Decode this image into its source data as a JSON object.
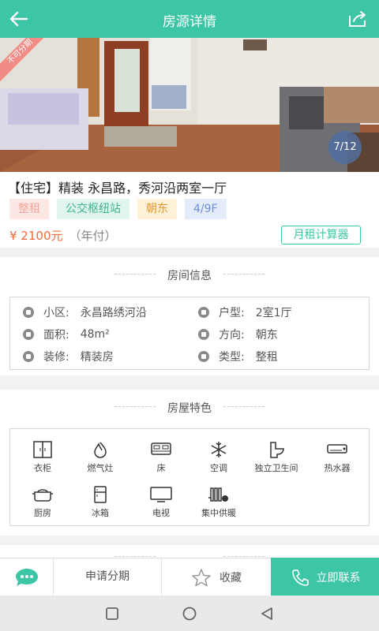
{
  "header": {
    "title": "房源详情",
    "back_icon": "arrow-left-icon",
    "share_icon": "share-icon",
    "bg_color": "#3dc6a5"
  },
  "gallery": {
    "ribbon": "不可分期",
    "counter": "7/12"
  },
  "listing": {
    "name": "【住宅】精装 永昌路，秀河沿两室一厅",
    "tags": [
      "整租",
      "公交枢纽站",
      "朝东",
      "4/9F"
    ],
    "price": "¥ 2100元",
    "price_unit": "（年付）",
    "calc_button": "月租计算器"
  },
  "room_info": {
    "title": "房间信息",
    "rows": [
      [
        {
          "label": "小区:",
          "value": "永昌路绣河沿",
          "icon": "community-icon"
        },
        {
          "label": "户型:",
          "value": "2室1厅",
          "icon": "layout-icon"
        }
      ],
      [
        {
          "label": "面积:",
          "value": "48m²",
          "icon": "area-icon"
        },
        {
          "label": "方向:",
          "value": "朝东",
          "icon": "direction-icon"
        }
      ],
      [
        {
          "label": "装修:",
          "value": "精装房",
          "icon": "decoration-icon"
        },
        {
          "label": "类型:",
          "value": "整租",
          "icon": "type-icon"
        }
      ]
    ]
  },
  "features": {
    "title": "房屋特色",
    "items": [
      {
        "label": "衣柜",
        "icon": "wardrobe-icon"
      },
      {
        "label": "燃气灶",
        "icon": "gas-stove-icon"
      },
      {
        "label": "床",
        "icon": "bed-icon"
      },
      {
        "label": "空调",
        "icon": "air-conditioner-icon"
      },
      {
        "label": "独立卫生间",
        "icon": "bathroom-icon"
      },
      {
        "label": "热水器",
        "icon": "water-heater-icon"
      },
      {
        "label": "厨房",
        "icon": "kitchen-icon"
      },
      {
        "label": "冰箱",
        "icon": "fridge-icon"
      },
      {
        "label": "电视",
        "icon": "tv-icon"
      },
      {
        "label": "集中供暖",
        "icon": "heating-icon"
      }
    ]
  },
  "bottom_bar": {
    "chat_icon": "chat-icon",
    "apply": "申请分期",
    "favorite": "收藏",
    "call": "立即联系"
  },
  "system_nav": {
    "recent": "recent-apps-icon",
    "home": "home-icon",
    "back": "back-triangle-icon"
  }
}
